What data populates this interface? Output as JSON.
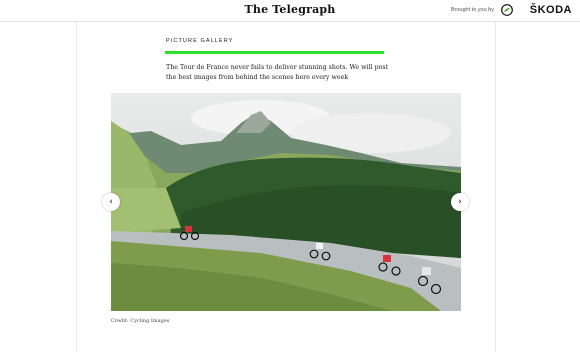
{
  "header": {
    "masthead": "The Telegraph",
    "sponsor_prefix": "Brought to you by",
    "sponsor_name": "ŠKODA"
  },
  "gallery": {
    "section_label": "PICTURE GALLERY",
    "intro": "The Tour de France never fails to deliver stunning shots. We will post the best images from behind the scenes here every week",
    "image_alt": "Cyclists descending a mountain road in the Pyrenees",
    "credit": "Credit: Cycling Images",
    "prev_icon": "chevron-left-icon",
    "next_icon": "chevron-right-icon"
  },
  "colors": {
    "accent": "#2ee02e",
    "skoda_green": "#4ba82e"
  }
}
